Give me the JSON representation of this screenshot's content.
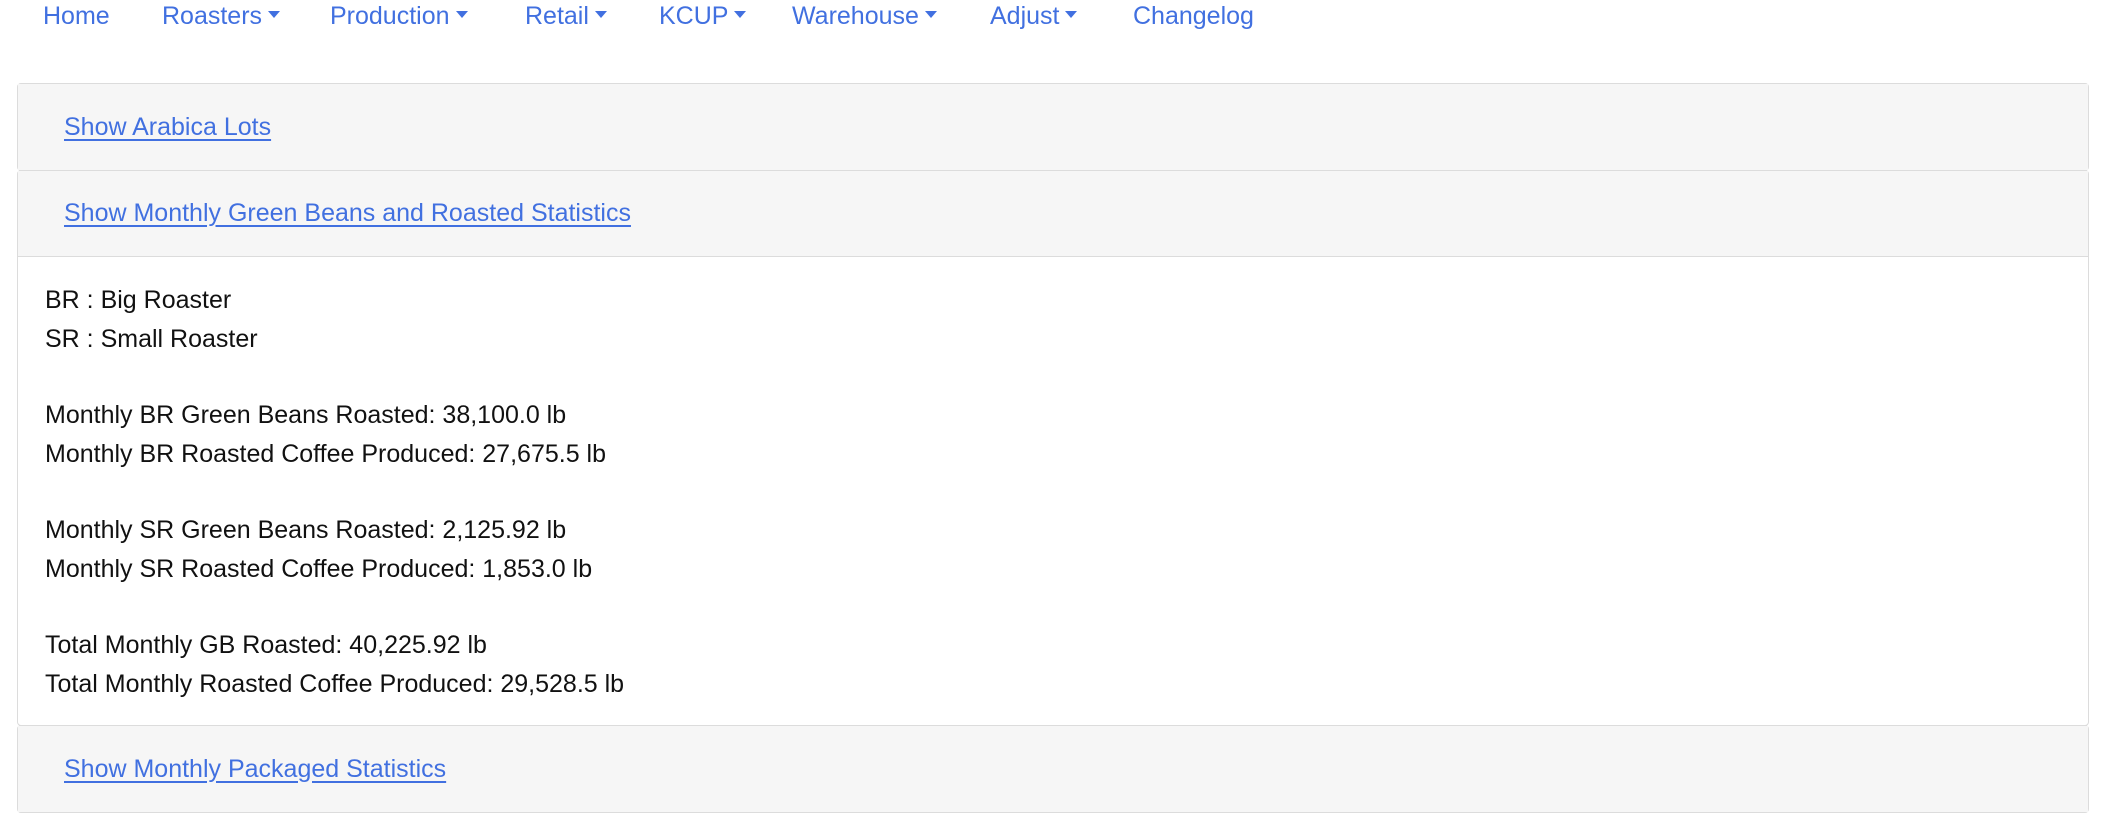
{
  "nav": {
    "items": [
      {
        "label": "Home",
        "dropdown": false
      },
      {
        "label": "Roasters",
        "dropdown": true
      },
      {
        "label": "Production",
        "dropdown": true
      },
      {
        "label": "Retail",
        "dropdown": true
      },
      {
        "label": "KCUP",
        "dropdown": true
      },
      {
        "label": "Warehouse",
        "dropdown": true
      },
      {
        "label": "Adjust",
        "dropdown": true
      },
      {
        "label": "Changelog",
        "dropdown": false
      }
    ]
  },
  "accordion": {
    "arabica": {
      "label": "Show Arabica Lots",
      "expanded": false
    },
    "green_roasted": {
      "label": "Show Monthly Green Beans and Roasted Statistics",
      "expanded": true,
      "legend": [
        "BR : Big Roaster",
        "SR : Small Roaster"
      ],
      "br": [
        "Monthly BR Green Beans Roasted: 38,100.0 lb",
        "Monthly BR Roasted Coffee Produced: 27,675.5 lb"
      ],
      "sr": [
        "Monthly SR Green Beans Roasted: 2,125.92 lb",
        "Monthly SR Roasted Coffee Produced: 1,853.0 lb"
      ],
      "total": [
        "Total Monthly GB Roasted: 40,225.92 lb",
        "Total Monthly Roasted Coffee Produced: 29,528.5 lb"
      ]
    },
    "packaged": {
      "label": "Show Monthly Packaged Statistics",
      "expanded": false
    }
  },
  "colors": {
    "link": "#4170e0",
    "header_bg": "#f6f6f6",
    "border": "#dcdcdc",
    "text": "#111111"
  }
}
